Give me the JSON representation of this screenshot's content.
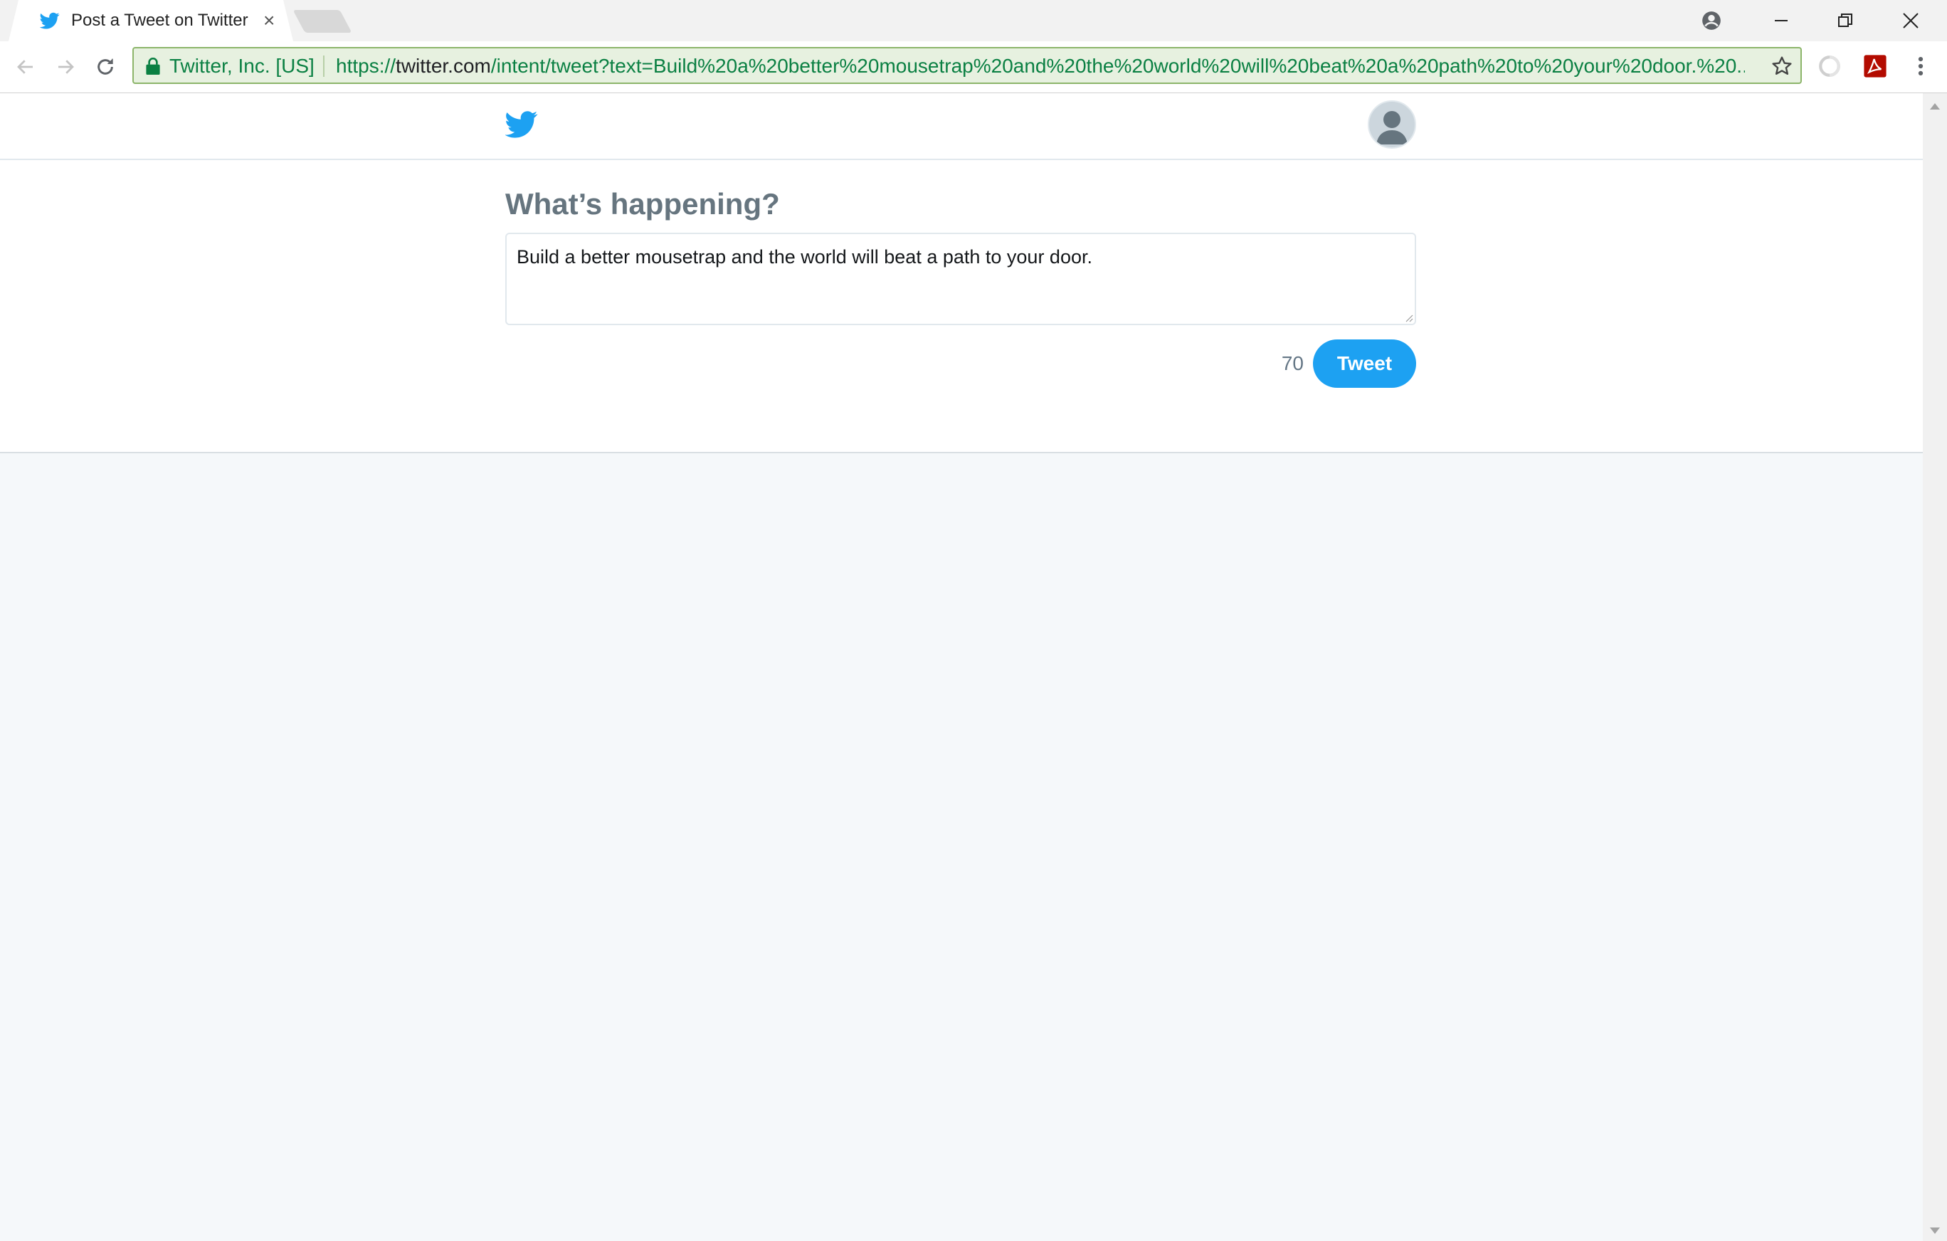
{
  "browser": {
    "tab_title": "Post a Tweet on Twitter",
    "tab_close": "×",
    "ev_label": "Twitter, Inc. [US]",
    "url_scheme": "https://",
    "url_host": "twitter.com",
    "url_path": "/intent/tweet?text=Build%20a%20better%20mousetrap%20and%20the%20world%20will%20beat%20a%20path%20to%20your%20door.%20..."
  },
  "page": {
    "heading": "What’s happening?",
    "tweet_text": "Build a better mousetrap and the world will beat a path to your door.",
    "char_count": "70",
    "tweet_button": "Tweet"
  },
  "colors": {
    "twitter_blue": "#1da1f2",
    "secure_green": "#0b8043",
    "heading_gray": "#66757f"
  },
  "icons": [
    "twitter-bird-icon",
    "lock-icon",
    "star-icon",
    "back-arrow-icon",
    "forward-arrow-icon",
    "reload-icon",
    "profile-icon",
    "minimize-icon",
    "restore-icon",
    "close-icon",
    "acrobat-icon",
    "menu-dots-icon",
    "avatar-icon"
  ]
}
